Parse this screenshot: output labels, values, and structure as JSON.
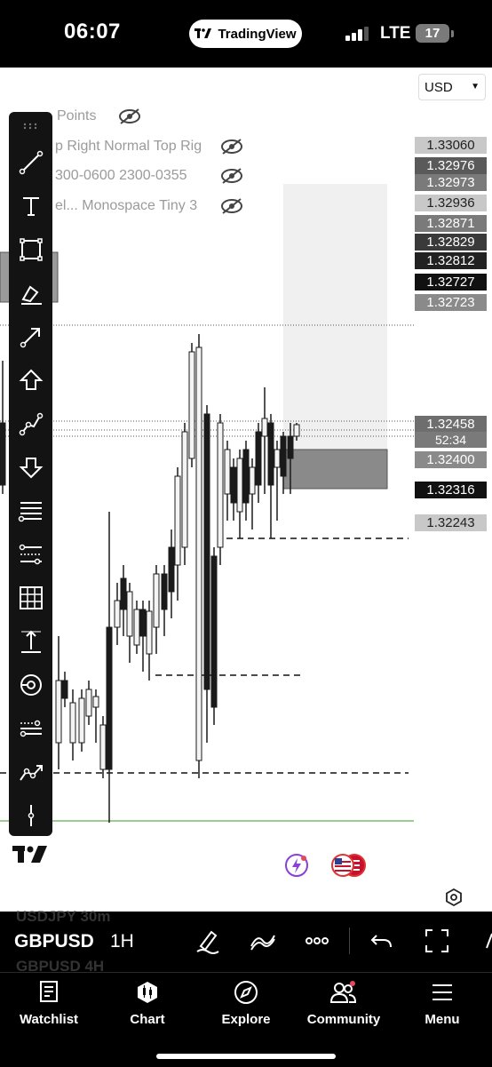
{
  "status_bar": {
    "time": "06:07",
    "app_pill": "TradingView",
    "network": "LTE",
    "battery": "17"
  },
  "chart": {
    "currency": "USD",
    "indicators": [
      {
        "text": "Points",
        "visible": false
      },
      {
        "text": "p Right Normal Top Rig",
        "visible": false
      },
      {
        "text": "300-0600 2300-0355",
        "visible": false
      },
      {
        "text": "el...   Monospace Tiny 3",
        "visible": false
      }
    ],
    "price_labels": [
      {
        "value": "1.33060",
        "color": "#c8c8c8",
        "text_color": "#222"
      },
      {
        "value": "1.32976",
        "color": "#5a5a5a",
        "text_color": "#fff"
      },
      {
        "value": "1.32973",
        "color": "#7a7a7a",
        "text_color": "#fff"
      },
      {
        "value": "1.32936",
        "color": "#c8c8c8",
        "text_color": "#222"
      },
      {
        "value": "1.32871",
        "color": "#7a7a7a",
        "text_color": "#fff"
      },
      {
        "value": "1.32829",
        "color": "#3a3a3a",
        "text_color": "#fff"
      },
      {
        "value": "1.32812",
        "color": "#222222",
        "text_color": "#fff"
      },
      {
        "value": "1.32727",
        "color": "#111111",
        "text_color": "#fff"
      },
      {
        "value": "1.32723",
        "color": "#8a8a8a",
        "text_color": "#fff"
      },
      {
        "value": "1.32458",
        "color": "#6e6e6e",
        "text_color": "#fff"
      },
      {
        "value": "1.32400",
        "color": "#8a8a8a",
        "text_color": "#fff"
      },
      {
        "value": "1.32316",
        "color": "#111111",
        "text_color": "#fff"
      },
      {
        "value": "1.32243",
        "color": "#c8c8c8",
        "text_color": "#222"
      }
    ],
    "countdown": "52:34",
    "tools": [
      "trend-line-icon",
      "text-icon",
      "rectangle-icon",
      "brush-icon",
      "arrow-icon",
      "arrow-up-icon",
      "path-icon",
      "arrow-down-icon",
      "fib-icon",
      "lines-icon",
      "grid-icon",
      "measure-icon",
      "circle-target-icon",
      "settings-lines-icon",
      "forecast-icon",
      "vertical-line-icon"
    ]
  },
  "symbol_bar": {
    "ghost_top": "USDJPY   30m",
    "symbol": "GBPUSD",
    "interval": "1H",
    "ghost_bottom": "GBPUSD   4H"
  },
  "tabs": [
    {
      "label": "Watchlist",
      "icon": "watchlist-icon"
    },
    {
      "label": "Chart",
      "icon": "chart-icon"
    },
    {
      "label": "Explore",
      "icon": "compass-icon"
    },
    {
      "label": "Community",
      "icon": "community-icon"
    },
    {
      "label": "Menu",
      "icon": "menu-icon"
    }
  ],
  "colors": {
    "background": "#ffffff",
    "toolbar": "#131313",
    "candle": "#1a1a1a"
  }
}
